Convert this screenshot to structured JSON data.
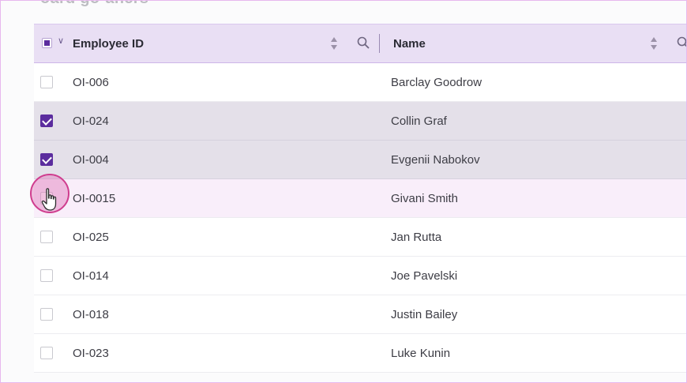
{
  "header": {
    "title_partial": "oard go-aners"
  },
  "table": {
    "columns": [
      {
        "key": "employee_id",
        "label": "Employee ID"
      },
      {
        "key": "name",
        "label": "Name"
      }
    ],
    "rows": [
      {
        "employee_id": "OI-006",
        "name": "Barclay Goodrow",
        "checked": false,
        "state": "normal"
      },
      {
        "employee_id": "OI-024",
        "name": "Collin Graf",
        "checked": true,
        "state": "selected"
      },
      {
        "employee_id": "OI-004",
        "name": "Evgenii Nabokov",
        "checked": true,
        "state": "selected"
      },
      {
        "employee_id": "OI-0015",
        "name": "Givani Smith",
        "checked": false,
        "state": "hover"
      },
      {
        "employee_id": "OI-025",
        "name": "Jan Rutta",
        "checked": false,
        "state": "normal"
      },
      {
        "employee_id": "OI-014",
        "name": "Joe Pavelski",
        "checked": false,
        "state": "normal"
      },
      {
        "employee_id": "OI-018",
        "name": "Justin Bailey",
        "checked": false,
        "state": "normal"
      },
      {
        "employee_id": "OI-023",
        "name": "Luke Kunin",
        "checked": false,
        "state": "normal"
      }
    ]
  },
  "colors": {
    "accent": "#5b2c9e",
    "header_bg": "#e9dff4",
    "selected_row_bg": "#e4e0e9",
    "hover_row_bg": "#f9eefa",
    "cursor_ring": "#cf3d8e"
  },
  "icons": {
    "sort": "sort-icon",
    "search": "search-icon",
    "chevron": "chevron-down-icon",
    "cursor": "hand-pointer-icon"
  }
}
